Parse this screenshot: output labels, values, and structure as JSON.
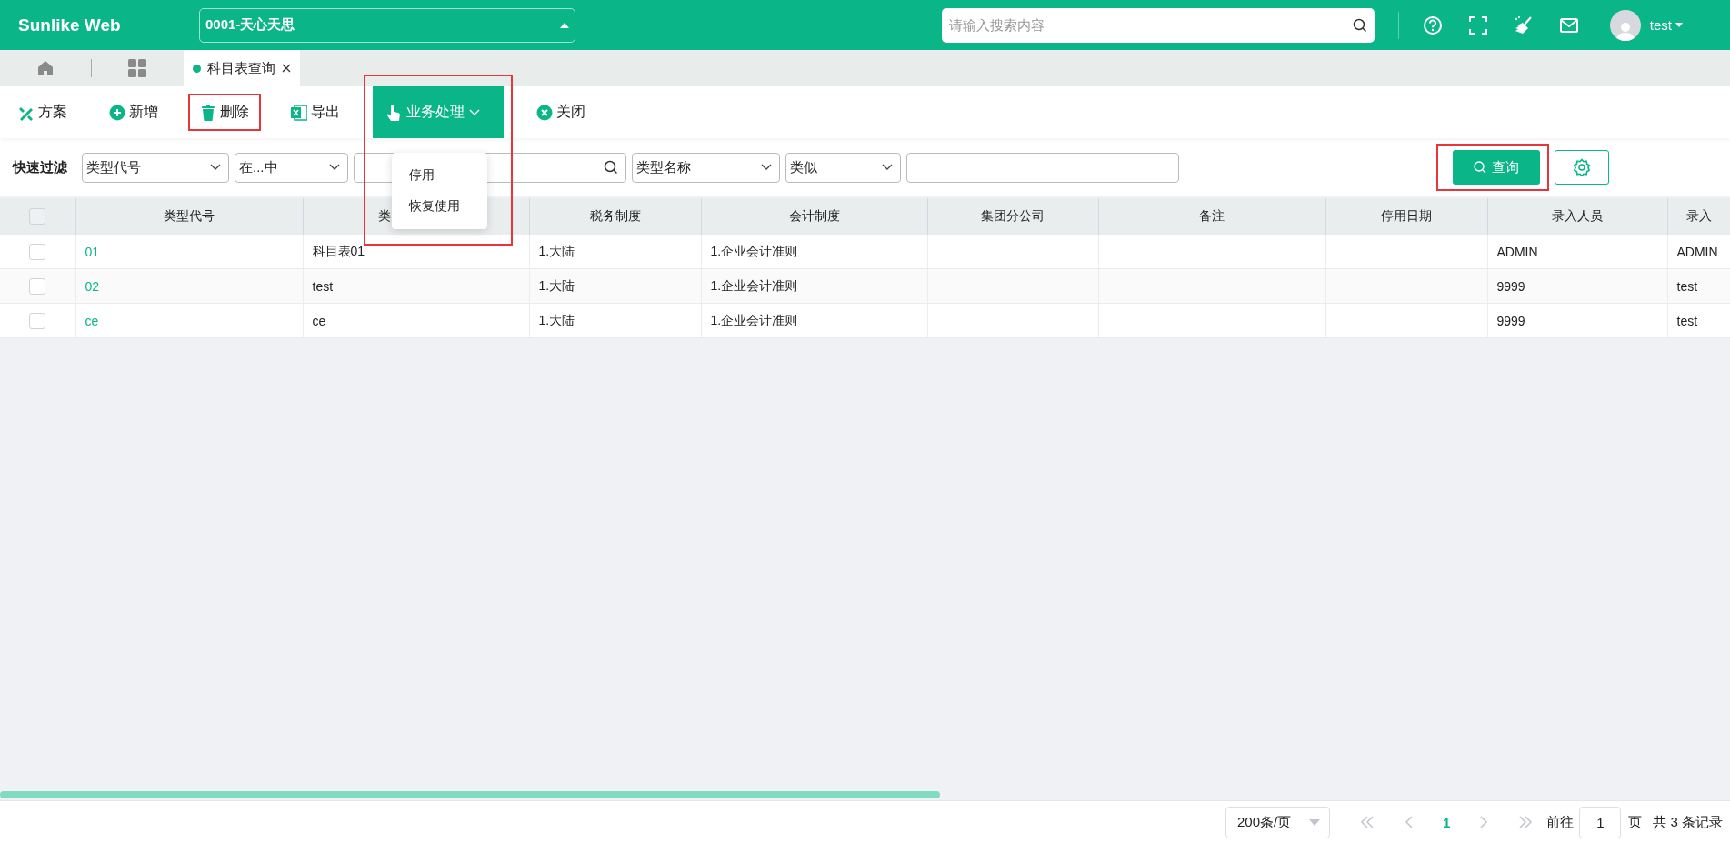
{
  "app": {
    "logo": "Sunlike Web",
    "company": "0001-天心天思",
    "search": {
      "placeholder": "请输入搜索内容"
    },
    "user": "test"
  },
  "tabs": [
    {
      "label": "科目表查询",
      "selected": true
    }
  ],
  "toolbar": [
    {
      "kind": "plan",
      "label": "方案",
      "highlighted": false
    },
    {
      "kind": "add",
      "label": "新增",
      "highlighted": false
    },
    {
      "kind": "delete",
      "label": "删除",
      "highlighted": true
    },
    {
      "kind": "export",
      "label": "导出",
      "highlighted": false
    },
    {
      "kind": "menu",
      "label": "业务处理",
      "highlighted": true,
      "expanded": true,
      "menu": [
        "停用",
        "恢复使用"
      ]
    },
    {
      "kind": "close",
      "label": "关闭",
      "highlighted": false
    }
  ],
  "filter": {
    "label": "快速过滤",
    "fields": [
      {
        "kind": "select",
        "value": "类型代号"
      },
      {
        "kind": "select",
        "value": "在...中"
      },
      {
        "kind": "search"
      },
      {
        "kind": "select",
        "value": "类型名称"
      },
      {
        "kind": "select",
        "value": "类似"
      },
      {
        "kind": "input"
      }
    ],
    "query": {
      "label": "查询",
      "highlighted": true
    }
  },
  "table": {
    "all_checked": false,
    "columns": [
      "类型代号",
      "类",
      "税务制度",
      "会计制度",
      "集团分公司",
      "备注",
      "停用日期",
      "录入人员",
      "录入"
    ],
    "rows": [
      {
        "checked": false,
        "cells": [
          "01",
          "科目表01",
          "1.大陆",
          "1.企业会计准则",
          null,
          null,
          null,
          "ADMIN",
          "ADMIN"
        ]
      },
      {
        "checked": false,
        "cells": [
          "02",
          "test",
          "1.大陆",
          "1.企业会计准则",
          null,
          null,
          null,
          "9999",
          "test"
        ]
      },
      {
        "checked": false,
        "cells": [
          "ce",
          "ce",
          "1.大陆",
          "1.企业会计准则",
          null,
          null,
          null,
          "9999",
          "test"
        ]
      }
    ]
  },
  "pager": {
    "page_size": "200条/页",
    "current": "1",
    "goto_label": "前往",
    "goto_value": "1",
    "page_suffix": "页",
    "total": "共 3 条记录"
  }
}
